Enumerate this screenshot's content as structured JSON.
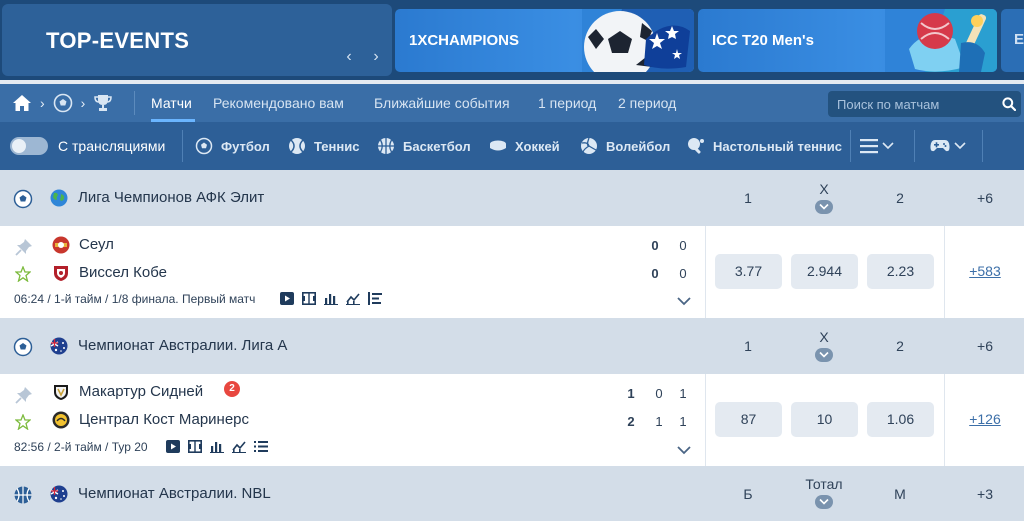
{
  "top_events": {
    "title": "TOP-EVENTS",
    "cards": [
      {
        "label": "1XCHAMPIONS"
      },
      {
        "label": "ICC T20 Men's"
      },
      {
        "label": "E"
      }
    ]
  },
  "nav": {
    "tabs": [
      {
        "label": "Матчи",
        "active": true
      },
      {
        "label": "Рекомендовано вам"
      },
      {
        "label": "Ближайшие события"
      },
      {
        "label": "1 период"
      },
      {
        "label": "2 период"
      }
    ],
    "search_placeholder": "Поиск по матчам"
  },
  "filters": {
    "toggle_label": "С трансляциями",
    "sports": [
      "Футбол",
      "Теннис",
      "Баскетбол",
      "Хоккей",
      "Волейбол",
      "Настольный теннис"
    ]
  },
  "leagues": [
    {
      "name": "Лига Чемпионов АФК Элит",
      "headers": [
        "1",
        "X",
        "2"
      ],
      "more": "+6",
      "match": {
        "team1": "Сеул",
        "team2": "Виссел Кобе",
        "score1": [
          "0",
          "0"
        ],
        "score2": [
          "0",
          "0"
        ],
        "info": "06:24 / 1-й тайм / 1/8 финала. Первый матч",
        "odds": [
          "3.77",
          "2.944",
          "2.23"
        ],
        "more": "+583"
      }
    },
    {
      "name": "Чемпионат Австралии. Лига А",
      "headers": [
        "1",
        "X",
        "2"
      ],
      "more": "+6",
      "match": {
        "team1": "Макартур Сидней",
        "team1_badge": "2",
        "team2": "Централ Кост Маринерс",
        "score1": [
          "1",
          "0",
          "1"
        ],
        "score2": [
          "2",
          "1",
          "1"
        ],
        "info": "82:56 / 2-й тайм / Тур 20",
        "odds": [
          "87",
          "10",
          "1.06"
        ],
        "more": "+126"
      }
    },
    {
      "name": "Чемпионат Австралии. NBL",
      "headers": [
        "Б",
        "Тотал",
        "М"
      ],
      "more": "+3"
    }
  ],
  "colors": {
    "header_bg": "#1d4a7a",
    "nav_bg": "#3a6ea7",
    "sport_bg": "#2d5f97",
    "league_bg": "#d3dde8",
    "link": "#3c6fa8",
    "badge_red": "#e8473f"
  }
}
